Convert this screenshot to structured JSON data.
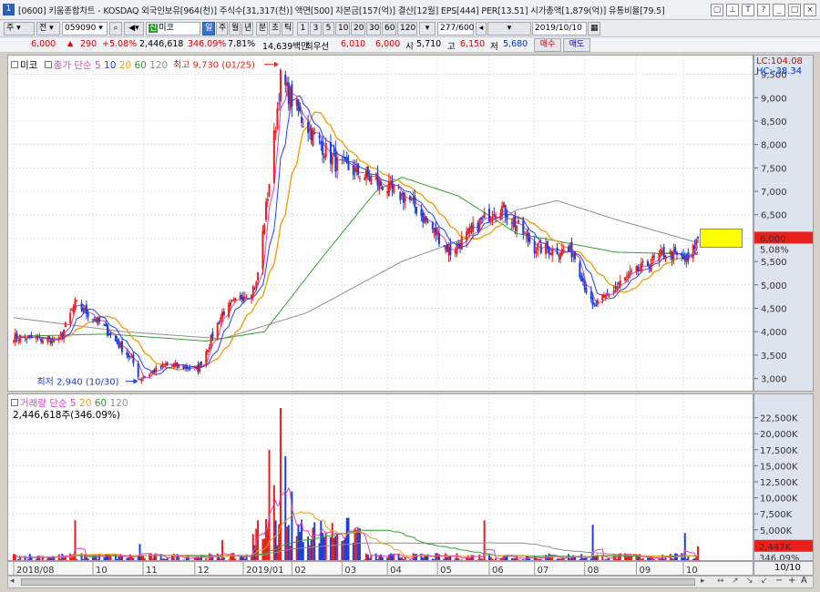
{
  "window": {
    "title": "[0600] 키움종합차트 - KOSDAQ 외국인보유[964(천)] 주식수[31,317(천)] 액면[500] 자본금[157(억)] 결산[12월] EPS[444] PER[13.51] 시가총액[1,879(억)] 유통비율[79.5]"
  },
  "toolbar": {
    "period": "주",
    "type": "전",
    "code": "059090",
    "name": "미코",
    "mode": "일",
    "periods": [
      "주",
      "월",
      "년",
      "분",
      "초",
      "틱"
    ],
    "minutes": [
      "1",
      "3",
      "5",
      "10",
      "20",
      "30",
      "60",
      "120"
    ],
    "count": "277",
    "count_total": "/600",
    "date": "2019/10/10"
  },
  "quote": {
    "price": "6,000",
    "arrow": "▲",
    "change": "290",
    "change_pct": "+5.08%",
    "volume": "2,446,618",
    "vol_pct": "346.09%",
    "turnover": "7.81%",
    "amount": "14,639백만",
    "best_label": "최우선",
    "best_ask": "6,010",
    "best_bid": "6,000",
    "open_label": "시",
    "open": "5,710",
    "high_label": "고",
    "high": "6,150",
    "low_label": "저",
    "low": "5,680",
    "buy_label": "매수",
    "sell_label": "매도"
  },
  "price_legend": {
    "name": "미코",
    "label": "종가 단순",
    "periods": [
      "5",
      "10",
      "20",
      "60",
      "120"
    ]
  },
  "volume_legend": {
    "label": "거래량 단순",
    "periods": [
      "5",
      "20",
      "60",
      "120"
    ],
    "current": "2,446,618주(346.09%)"
  },
  "annotations": {
    "high": "최고 9,730 (01/25)",
    "low": "최저 2,940 (10/30)"
  },
  "price_scale": {
    "lc": "LC:104.08",
    "hc": "HC:-38.34",
    "current_price": "6,000",
    "current_pct": "5.08%"
  },
  "volume_scale": {
    "current": "2,447K",
    "pct": "346.09%"
  },
  "date_corner": "10/10",
  "colors": {
    "up": "#e8201c",
    "down": "#1c3fd8",
    "ma5": "#e040c0",
    "ma10": "#2040ff",
    "ma20": "#f0a010",
    "ma60": "#30a030",
    "ma120": "#909090"
  },
  "chart_data": {
    "type": "candlestick",
    "ylim": [
      2700,
      9900
    ],
    "y_ticks": [
      3000,
      3500,
      4000,
      4500,
      5000,
      5500,
      6000,
      6500,
      7000,
      7500,
      8000,
      8500,
      9000,
      9500
    ],
    "vol_ylim": [
      0,
      25000
    ],
    "vol_ticks": [
      5000,
      7500,
      10000,
      12500,
      15000,
      17500,
      20000,
      22500
    ],
    "vol_tick_labels": [
      "5,000K",
      "7,500K",
      "10,000K",
      "12,500K",
      "15,000K",
      "17,500K",
      "20,000K",
      "22,500K"
    ],
    "months": [
      "2018/08",
      "10",
      "11",
      "12",
      "2019/01",
      "02",
      "03",
      "04",
      "05",
      "06",
      "07",
      "08",
      "09",
      "10"
    ],
    "close_keypoints": [
      {
        "date": "2018-08-13",
        "close": 3900
      },
      {
        "date": "2018-09-10",
        "close": 3800
      },
      {
        "date": "2018-09-20",
        "close": 4600
      },
      {
        "date": "2018-10-05",
        "close": 4200
      },
      {
        "date": "2018-10-25",
        "close": 3400
      },
      {
        "date": "2018-10-30",
        "close": 3000
      },
      {
        "date": "2018-11-15",
        "close": 3300
      },
      {
        "date": "2018-12-05",
        "close": 3200
      },
      {
        "date": "2018-12-20",
        "close": 4400
      },
      {
        "date": "2019-01-10",
        "close": 5000
      },
      {
        "date": "2019-01-18",
        "close": 7200
      },
      {
        "date": "2019-01-25",
        "close": 9400
      },
      {
        "date": "2019-02-08",
        "close": 8500
      },
      {
        "date": "2019-02-28",
        "close": 7600
      },
      {
        "date": "2019-03-20",
        "close": 7300
      },
      {
        "date": "2019-04-15",
        "close": 6800
      },
      {
        "date": "2019-05-10",
        "close": 5700
      },
      {
        "date": "2019-05-30",
        "close": 6400
      },
      {
        "date": "2019-06-10",
        "close": 6700
      },
      {
        "date": "2019-07-01",
        "close": 5800
      },
      {
        "date": "2019-07-25",
        "close": 5700
      },
      {
        "date": "2019-08-06",
        "close": 4500
      },
      {
        "date": "2019-08-25",
        "close": 5100
      },
      {
        "date": "2019-09-20",
        "close": 5700
      },
      {
        "date": "2019-10-04",
        "close": 5500
      },
      {
        "date": "2019-10-10",
        "close": 6000
      }
    ],
    "ma60_keypoints": [
      {
        "date": "2018-08-13",
        "value": 3900
      },
      {
        "date": "2018-10-10",
        "value": 3950
      },
      {
        "date": "2018-12-10",
        "value": 3800
      },
      {
        "date": "2019-01-15",
        "value": 4000
      },
      {
        "date": "2019-02-20",
        "value": 5600
      },
      {
        "date": "2019-03-25",
        "value": 7000
      },
      {
        "date": "2019-04-10",
        "value": 7300
      },
      {
        "date": "2019-05-15",
        "value": 6900
      },
      {
        "date": "2019-06-20",
        "value": 6100
      },
      {
        "date": "2019-08-20",
        "value": 5700
      },
      {
        "date": "2019-10-10",
        "value": 5650
      }
    ],
    "ma120_keypoints": [
      {
        "date": "2018-08-13",
        "value": 4300
      },
      {
        "date": "2018-10-20",
        "value": 4000
      },
      {
        "date": "2018-12-20",
        "value": 3850
      },
      {
        "date": "2019-02-10",
        "value": 4400
      },
      {
        "date": "2019-04-10",
        "value": 5500
      },
      {
        "date": "2019-05-20",
        "value": 6000
      },
      {
        "date": "2019-06-20",
        "value": 6600
      },
      {
        "date": "2019-07-15",
        "value": 6800
      },
      {
        "date": "2019-08-20",
        "value": 6400
      },
      {
        "date": "2019-10-10",
        "value": 5900
      }
    ],
    "volume_spikes": [
      {
        "date": "2018-09-20",
        "value": 6500
      },
      {
        "date": "2018-10-30",
        "value": 2800
      },
      {
        "date": "2018-12-20",
        "value": 3400
      },
      {
        "date": "2019-01-11",
        "value": 6500
      },
      {
        "date": "2019-01-18",
        "value": 17500
      },
      {
        "date": "2019-01-21",
        "value": 12000
      },
      {
        "date": "2019-01-25",
        "value": 24000
      },
      {
        "date": "2019-01-28",
        "value": 16500
      },
      {
        "date": "2019-02-01",
        "value": 11000
      },
      {
        "date": "2019-05-31",
        "value": 6500
      },
      {
        "date": "2019-08-06",
        "value": 5800
      },
      {
        "date": "2019-10-02",
        "value": 4500
      },
      {
        "date": "2019-10-10",
        "value": 2447
      }
    ]
  }
}
